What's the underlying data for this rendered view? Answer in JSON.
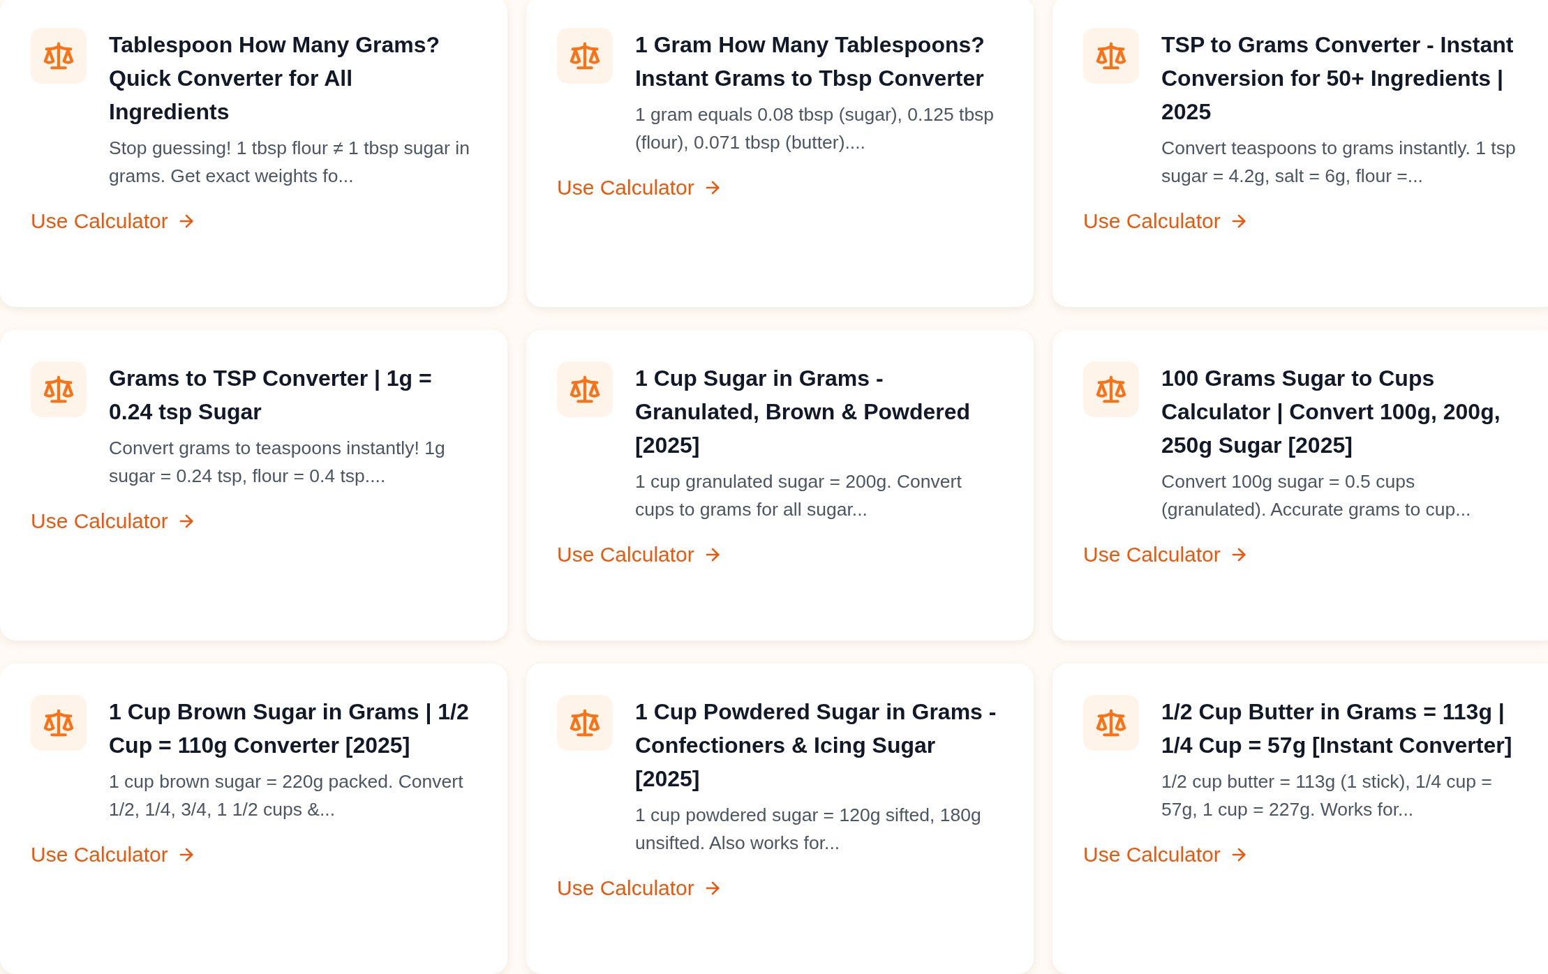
{
  "cards": [
    {
      "title": "Tablespoon How Many Grams? Quick Converter for All Ingredients",
      "description": "Stop guessing! 1 tbsp flour ≠ 1 tbsp sugar in grams. Get exact weights fo...",
      "link": "Use Calculator"
    },
    {
      "title": "1 Gram How Many Tablespoons? Instant Grams to Tbsp Converter",
      "description": "1 gram equals 0.08 tbsp (sugar), 0.125 tbsp (flour), 0.071 tbsp (butter)....",
      "link": "Use Calculator"
    },
    {
      "title": "TSP to Grams Converter - Instant Conversion for 50+ Ingredients | 2025",
      "description": "Convert teaspoons to grams instantly. 1 tsp sugar = 4.2g, salt = 6g, flour =...",
      "link": "Use Calculator"
    },
    {
      "title": "Grams to TSP Converter | 1g = 0.24 tsp Sugar",
      "description": "Convert grams to teaspoons instantly! 1g sugar = 0.24 tsp, flour = 0.4 tsp....",
      "link": "Use Calculator"
    },
    {
      "title": "1 Cup Sugar in Grams - Granulated, Brown & Powdered [2025]",
      "description": "1 cup granulated sugar = 200g. Convert cups to grams for all sugar...",
      "link": "Use Calculator"
    },
    {
      "title": "100 Grams Sugar to Cups Calculator | Convert 100g, 200g, 250g Sugar [2025]",
      "description": "Convert 100g sugar = 0.5 cups (granulated). Accurate grams to cup...",
      "link": "Use Calculator"
    },
    {
      "title": "1 Cup Brown Sugar in Grams | 1/2 Cup = 110g Converter [2025]",
      "description": "1 cup brown sugar = 220g packed. Convert 1/2, 1/4, 3/4, 1 1/2 cups &...",
      "link": "Use Calculator"
    },
    {
      "title": "1 Cup Powdered Sugar in Grams - Confectioners & Icing Sugar [2025]",
      "description": "1 cup powdered sugar = 120g sifted, 180g unsifted. Also works for...",
      "link": "Use Calculator"
    },
    {
      "title": "1/2 Cup Butter in Grams = 113g | 1/4 Cup = 57g [Instant Converter]",
      "description": "1/2 cup butter = 113g (1 stick), 1/4 cup = 57g, 1 cup = 227g. Works for...",
      "link": "Use Calculator"
    }
  ]
}
